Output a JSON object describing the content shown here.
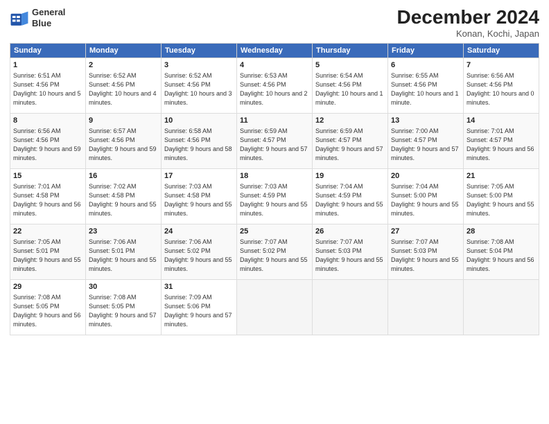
{
  "header": {
    "logo_line1": "General",
    "logo_line2": "Blue",
    "month_title": "December 2024",
    "location": "Konan, Kochi, Japan"
  },
  "weekdays": [
    "Sunday",
    "Monday",
    "Tuesday",
    "Wednesday",
    "Thursday",
    "Friday",
    "Saturday"
  ],
  "weeks": [
    [
      {
        "day": 1,
        "sunrise": "6:51 AM",
        "sunset": "4:56 PM",
        "daylight": "10 hours and 5 minutes."
      },
      {
        "day": 2,
        "sunrise": "6:52 AM",
        "sunset": "4:56 PM",
        "daylight": "10 hours and 4 minutes."
      },
      {
        "day": 3,
        "sunrise": "6:52 AM",
        "sunset": "4:56 PM",
        "daylight": "10 hours and 3 minutes."
      },
      {
        "day": 4,
        "sunrise": "6:53 AM",
        "sunset": "4:56 PM",
        "daylight": "10 hours and 2 minutes."
      },
      {
        "day": 5,
        "sunrise": "6:54 AM",
        "sunset": "4:56 PM",
        "daylight": "10 hours and 1 minute."
      },
      {
        "day": 6,
        "sunrise": "6:55 AM",
        "sunset": "4:56 PM",
        "daylight": "10 hours and 1 minute."
      },
      {
        "day": 7,
        "sunrise": "6:56 AM",
        "sunset": "4:56 PM",
        "daylight": "10 hours and 0 minutes."
      }
    ],
    [
      {
        "day": 8,
        "sunrise": "6:56 AM",
        "sunset": "4:56 PM",
        "daylight": "9 hours and 59 minutes."
      },
      {
        "day": 9,
        "sunrise": "6:57 AM",
        "sunset": "4:56 PM",
        "daylight": "9 hours and 59 minutes."
      },
      {
        "day": 10,
        "sunrise": "6:58 AM",
        "sunset": "4:56 PM",
        "daylight": "9 hours and 58 minutes."
      },
      {
        "day": 11,
        "sunrise": "6:59 AM",
        "sunset": "4:57 PM",
        "daylight": "9 hours and 57 minutes."
      },
      {
        "day": 12,
        "sunrise": "6:59 AM",
        "sunset": "4:57 PM",
        "daylight": "9 hours and 57 minutes."
      },
      {
        "day": 13,
        "sunrise": "7:00 AM",
        "sunset": "4:57 PM",
        "daylight": "9 hours and 57 minutes."
      },
      {
        "day": 14,
        "sunrise": "7:01 AM",
        "sunset": "4:57 PM",
        "daylight": "9 hours and 56 minutes."
      }
    ],
    [
      {
        "day": 15,
        "sunrise": "7:01 AM",
        "sunset": "4:58 PM",
        "daylight": "9 hours and 56 minutes."
      },
      {
        "day": 16,
        "sunrise": "7:02 AM",
        "sunset": "4:58 PM",
        "daylight": "9 hours and 55 minutes."
      },
      {
        "day": 17,
        "sunrise": "7:03 AM",
        "sunset": "4:58 PM",
        "daylight": "9 hours and 55 minutes."
      },
      {
        "day": 18,
        "sunrise": "7:03 AM",
        "sunset": "4:59 PM",
        "daylight": "9 hours and 55 minutes."
      },
      {
        "day": 19,
        "sunrise": "7:04 AM",
        "sunset": "4:59 PM",
        "daylight": "9 hours and 55 minutes."
      },
      {
        "day": 20,
        "sunrise": "7:04 AM",
        "sunset": "5:00 PM",
        "daylight": "9 hours and 55 minutes."
      },
      {
        "day": 21,
        "sunrise": "7:05 AM",
        "sunset": "5:00 PM",
        "daylight": "9 hours and 55 minutes."
      }
    ],
    [
      {
        "day": 22,
        "sunrise": "7:05 AM",
        "sunset": "5:01 PM",
        "daylight": "9 hours and 55 minutes."
      },
      {
        "day": 23,
        "sunrise": "7:06 AM",
        "sunset": "5:01 PM",
        "daylight": "9 hours and 55 minutes."
      },
      {
        "day": 24,
        "sunrise": "7:06 AM",
        "sunset": "5:02 PM",
        "daylight": "9 hours and 55 minutes."
      },
      {
        "day": 25,
        "sunrise": "7:07 AM",
        "sunset": "5:02 PM",
        "daylight": "9 hours and 55 minutes."
      },
      {
        "day": 26,
        "sunrise": "7:07 AM",
        "sunset": "5:03 PM",
        "daylight": "9 hours and 55 minutes."
      },
      {
        "day": 27,
        "sunrise": "7:07 AM",
        "sunset": "5:03 PM",
        "daylight": "9 hours and 55 minutes."
      },
      {
        "day": 28,
        "sunrise": "7:08 AM",
        "sunset": "5:04 PM",
        "daylight": "9 hours and 56 minutes."
      }
    ],
    [
      {
        "day": 29,
        "sunrise": "7:08 AM",
        "sunset": "5:05 PM",
        "daylight": "9 hours and 56 minutes."
      },
      {
        "day": 30,
        "sunrise": "7:08 AM",
        "sunset": "5:05 PM",
        "daylight": "9 hours and 57 minutes."
      },
      {
        "day": 31,
        "sunrise": "7:09 AM",
        "sunset": "5:06 PM",
        "daylight": "9 hours and 57 minutes."
      },
      null,
      null,
      null,
      null
    ]
  ]
}
